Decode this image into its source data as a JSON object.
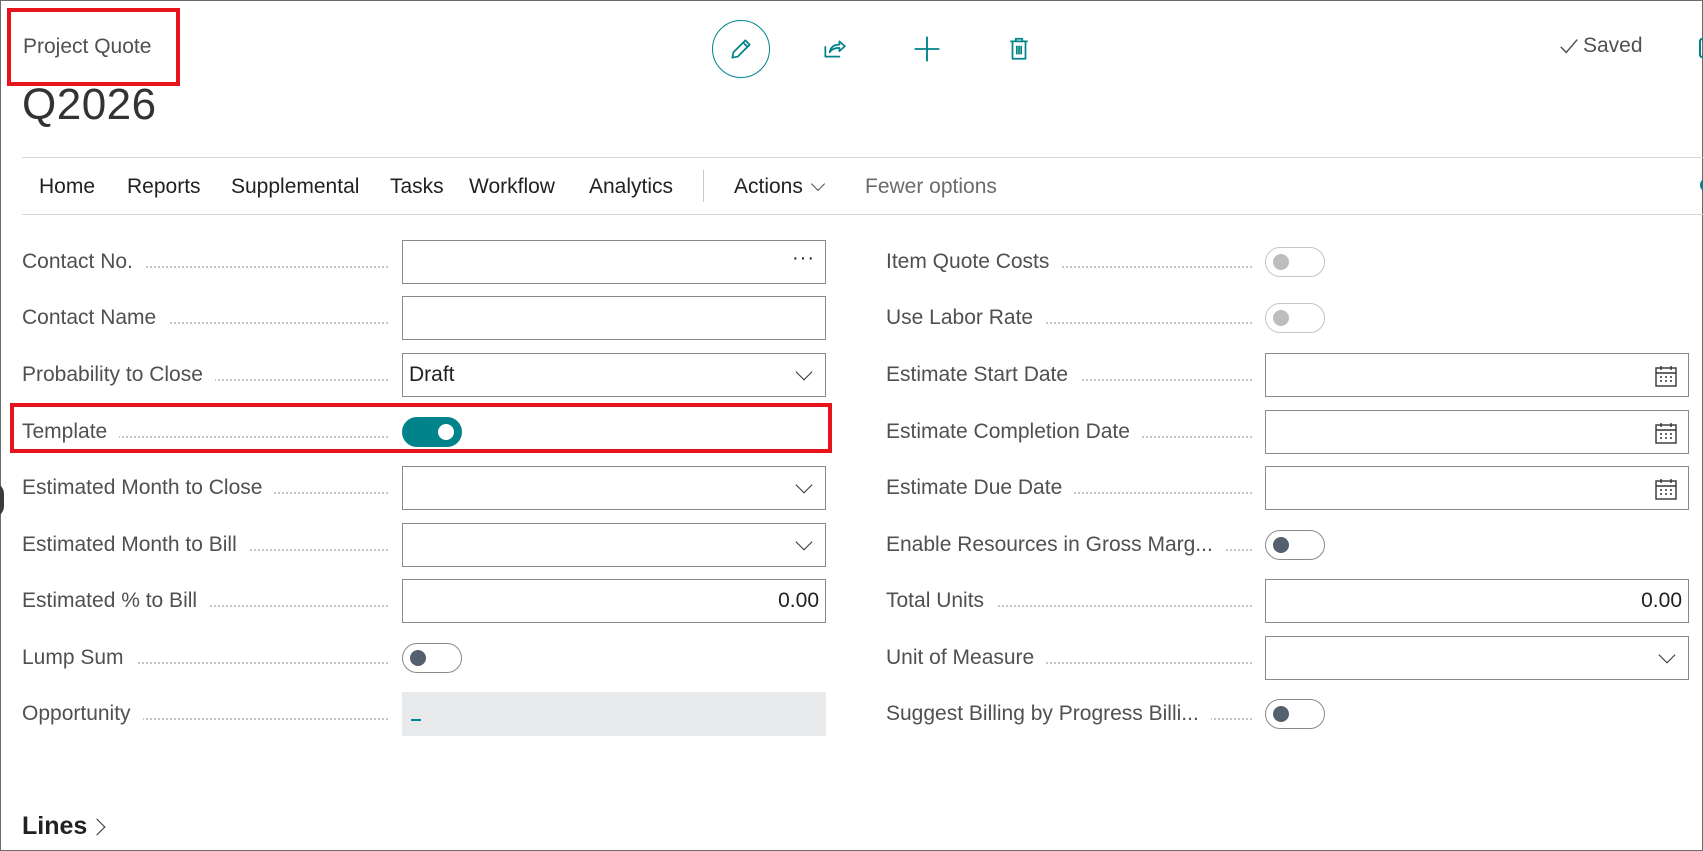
{
  "header": {
    "caption": "Project Quote",
    "record_title": "Q2026",
    "status": "Saved",
    "toolbar": [
      {
        "name": "edit",
        "icon": "pencil-icon"
      },
      {
        "name": "share",
        "icon": "share-icon"
      },
      {
        "name": "new",
        "icon": "plus-icon"
      },
      {
        "name": "delete",
        "icon": "trash-icon"
      }
    ]
  },
  "actionbar": {
    "items": [
      "Home",
      "Reports",
      "Supplemental",
      "Tasks",
      "Workflow",
      "Analytics"
    ],
    "actions_label": "Actions",
    "fewer_label": "Fewer options"
  },
  "left_fields": [
    {
      "label": "Contact No.",
      "type": "lookup",
      "value": ""
    },
    {
      "label": "Contact Name",
      "type": "text",
      "value": ""
    },
    {
      "label": "Probability to Close",
      "type": "dropdown",
      "value": "Draft"
    },
    {
      "label": "Template",
      "type": "toggle",
      "value": true
    },
    {
      "label": "Estimated Month to Close",
      "type": "dropdown",
      "value": ""
    },
    {
      "label": "Estimated Month to Bill",
      "type": "dropdown",
      "value": ""
    },
    {
      "label": "Estimated % to Bill",
      "type": "number",
      "value": "0.00"
    },
    {
      "label": "Lump Sum",
      "type": "toggle",
      "value": false
    },
    {
      "label": "Opportunity",
      "type": "readonly",
      "value": ""
    }
  ],
  "right_fields": [
    {
      "label": "Item Quote Costs",
      "type": "toggle-disabled",
      "value": false
    },
    {
      "label": "Use Labor Rate",
      "type": "toggle-disabled",
      "value": false
    },
    {
      "label": "Estimate Start Date",
      "type": "date",
      "value": ""
    },
    {
      "label": "Estimate Completion Date",
      "type": "date",
      "value": ""
    },
    {
      "label": "Estimate Due Date",
      "type": "date",
      "value": ""
    },
    {
      "label": "Enable Resources in Gross Marg...",
      "type": "toggle",
      "value": false
    },
    {
      "label": "Total Units",
      "type": "number",
      "value": "0.00"
    },
    {
      "label": "Unit of Measure",
      "type": "dropdown",
      "value": ""
    },
    {
      "label": "Suggest Billing by Progress Billi...",
      "type": "toggle",
      "value": false
    }
  ],
  "sections": {
    "lines_label": "Lines"
  },
  "colors": {
    "accent": "#00838a",
    "highlight": "#e8141b"
  }
}
